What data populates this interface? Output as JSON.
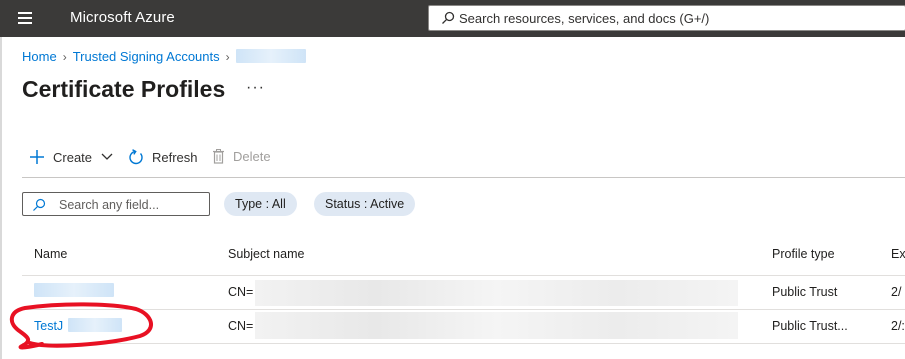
{
  "header": {
    "brand": "Microsoft Azure",
    "search_placeholder": "Search resources, services, and docs (G+/)"
  },
  "breadcrumb": {
    "items": [
      "Home",
      "Trusted Signing Accounts"
    ]
  },
  "page": {
    "title": "Certificate Profiles",
    "more_label": "···"
  },
  "toolbar": {
    "create_label": "Create",
    "refresh_label": "Refresh",
    "delete_label": "Delete"
  },
  "filters": {
    "search_placeholder": "Search any field...",
    "type_pill": "Type : All",
    "status_pill": "Status : Active"
  },
  "table": {
    "columns": [
      "Name",
      "Subject name",
      "Profile type",
      "Ex"
    ],
    "rows": [
      {
        "name": "",
        "subject_prefix": "CN=",
        "profile_type": "Public Trust",
        "expiry": "2/"
      },
      {
        "name": "TestJ",
        "subject_prefix": "CN=",
        "profile_type": "Public Trust...",
        "expiry": "2/:"
      }
    ]
  },
  "colors": {
    "topbar": "#3b3a39",
    "link": "#0078d4",
    "pill": "#dfe8f3",
    "annotation": "#e81123"
  },
  "icons": [
    "hamburger-icon",
    "search-icon",
    "chevron-right-icon",
    "ellipsis-icon",
    "plus-icon",
    "chevron-down-icon",
    "refresh-icon",
    "trash-icon"
  ]
}
